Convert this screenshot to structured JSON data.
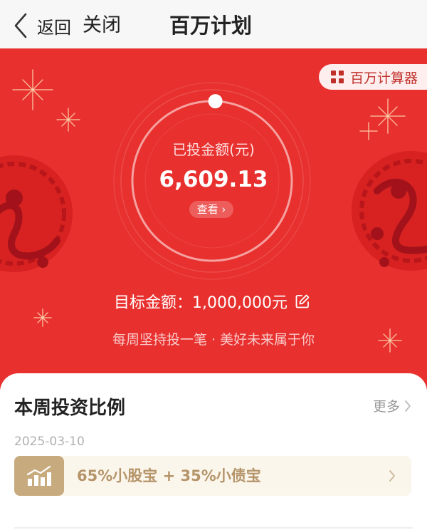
{
  "nav": {
    "back_label": "返回",
    "close_label": "关闭",
    "title": "百万计划"
  },
  "hero": {
    "calculator_label": "百万计算器",
    "invested_label": "已投金额(元)",
    "invested_amount": "6,609.13",
    "view_label": "查看 ›",
    "target_label": "目标金额：",
    "target_amount": "1,000,000元",
    "slogan": "每周坚持投一笔 · 美好未来属于你",
    "progress_fraction": 0.0066
  },
  "weekly": {
    "title": "本周投资比例",
    "more_label": "更多",
    "date": "2025-03-10",
    "allocation_text": "65%小股宝 + 35%小债宝"
  },
  "colors": {
    "hero_red": "#e8302e",
    "gold": "#c7aa7d",
    "gold_text": "#b5946a"
  },
  "icons": [
    "back-arrow-icon",
    "calculator-grid-icon",
    "edit-icon",
    "chevron-right-icon",
    "bar-chart-growth-icon",
    "firework-icon",
    "snake-papercut-icon"
  ]
}
